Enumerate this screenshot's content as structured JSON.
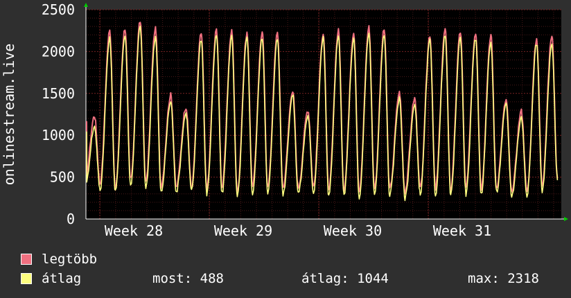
{
  "chart_data": {
    "type": "line",
    "ylabel": "onlinestream.live",
    "ylim": [
      0,
      2500
    ],
    "yticks": [
      0,
      500,
      1000,
      1500,
      2000,
      2500
    ],
    "x_labels": [
      "Week 28",
      "Week 29",
      "Week 30",
      "Week 31"
    ],
    "grid": true,
    "legend_placement": "bottom-left",
    "background": "#2f2f2f",
    "plot_background": "#000000",
    "grid_color": "#5a1a1a",
    "series": [
      {
        "name": "legtöbb",
        "color": "#f07080",
        "peaks": [
          1230,
          2250,
          2280,
          2360,
          2280,
          1480,
          1340,
          2220,
          2260,
          2250,
          2220,
          2230,
          2220,
          1540,
          1300,
          2220,
          2250,
          2230,
          2290,
          2260,
          1510,
          1440,
          2200,
          2260,
          2240,
          2230,
          2200,
          1420,
          1290,
          2150,
          2190
        ],
        "troughs": [
          430,
          360,
          470,
          440,
          400,
          380,
          380,
          360,
          380,
          330,
          380,
          380,
          380,
          380,
          390,
          340,
          350,
          320,
          370,
          360,
          330,
          360,
          360,
          350,
          370,
          370,
          380,
          320,
          330,
          420,
          510
        ]
      },
      {
        "name": "átlag",
        "color": "#ffff80",
        "peaks": [
          1100,
          2150,
          2190,
          2290,
          2180,
          1400,
          1260,
          2150,
          2200,
          2180,
          2150,
          2160,
          2150,
          1480,
          1230,
          2160,
          2170,
          2150,
          2220,
          2190,
          1440,
          1360,
          2130,
          2190,
          2160,
          2150,
          2100,
          1360,
          1210,
          2100,
          2080
        ],
        "troughs": [
          350,
          320,
          400,
          360,
          320,
          330,
          330,
          300,
          300,
          260,
          300,
          300,
          300,
          310,
          320,
          280,
          290,
          230,
          290,
          280,
          250,
          300,
          290,
          280,
          300,
          300,
          320,
          280,
          290,
          330,
          488
        ]
      }
    ]
  },
  "legend": {
    "max_label": "legtöbb",
    "avg_label": "átlag",
    "now": "most: 488",
    "avg": "átlag: 1044",
    "max": "max: 2318"
  }
}
